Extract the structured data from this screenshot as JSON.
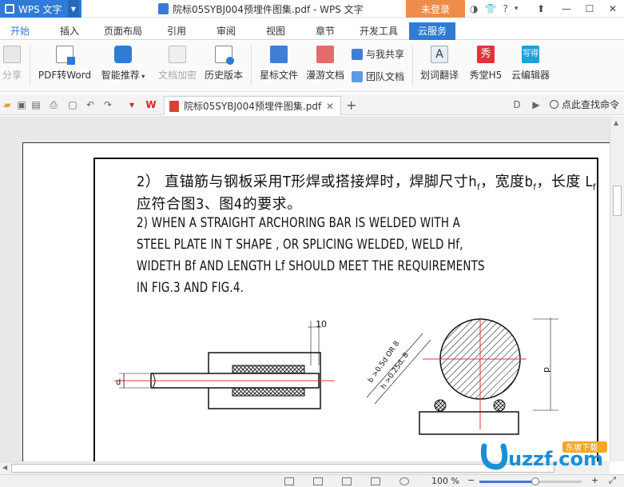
{
  "titlebar": {
    "app_name": "WPS 文字",
    "document_title": "院标05SYBJ004预埋件图集.pdf - WPS 文字",
    "login_label": "未登录",
    "help_label": "?"
  },
  "menu": {
    "tabs": [
      "开始",
      "插入",
      "页面布局",
      "引用",
      "审阅",
      "视图",
      "章节",
      "开发工具",
      "云服务"
    ],
    "active_tab": "云服务"
  },
  "ribbon": {
    "share": "分享",
    "pdf_to_word": "PDF转Word",
    "smart_recommend": "智能推荐",
    "doc_encrypt": "文档加密",
    "history": "历史版本",
    "star_files": "星标文件",
    "roam_docs": "漫游文档",
    "share_with_me": "与我共享",
    "team_docs": "团队文档",
    "translate": "划词翻译",
    "xiutang": "秀堂H5",
    "cloud_editor": "云编辑器",
    "translate_glyph": "A",
    "xiutang_glyph": "秀",
    "editor_glyph": "写得"
  },
  "doc_tabs": {
    "active_file": "院标05SYBJ004预埋件图集.pdf",
    "search_label": "点此查找命令"
  },
  "document": {
    "cn_line1_a": "2） 直锚筋与钢板采用T形焊或搭接焊时，焊脚尺寸h",
    "cn_line1_sub_f1": "f",
    "cn_line1_b": "，宽度b",
    "cn_line1_sub_f2": "f",
    "cn_line1_c": "，长度 L",
    "cn_line1_sub_f3": "f",
    "cn_line2": "应符合图3、图4的要求。",
    "en_line1": "2) WHEN A STRAIGHT ARCHORING BAR IS WELDED WITH A",
    "en_line2": "STEEL PLATE IN T SHAPE , OR SPLICING WELDED, WELD Hf,",
    "en_line3": "WIDETH Bf AND LENGTH Lf SHOULD MEET THE REQUIREMENTS",
    "en_line4": "IN FIG.3 AND FIG.4.",
    "dim_10": "10",
    "dim_d": "d",
    "dim_d2": "d",
    "dim_bf": "b >0.5d OR 8",
    "dim_hf": "h >0.25d, 8"
  },
  "statusbar": {
    "zoom": "100 %",
    "zoom_value": 0.55,
    "minus": "−",
    "plus": "+"
  },
  "watermark": {
    "brand": "uzzf.com",
    "badge": "东坡下载"
  },
  "colors": {
    "accent": "#2f7bd6",
    "login": "#f08c49",
    "red_line": "#e23a3a"
  }
}
